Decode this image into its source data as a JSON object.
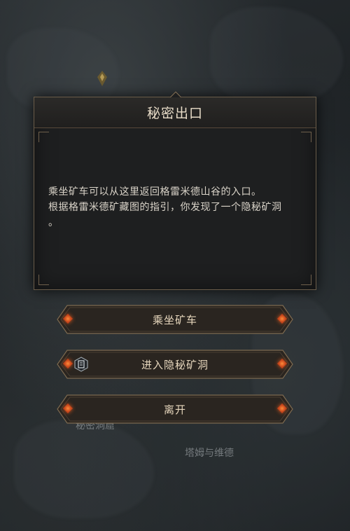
{
  "background": {
    "label_partial": "秘密洞窟",
    "label_npc": "塔姆与维德"
  },
  "dialog": {
    "title": "秘密出口",
    "line1": "乘坐矿车可以从这里返回格雷米德山谷的入口。",
    "line2": "根据格雷米德矿藏图的指引，你发现了一个隐秘矿洞",
    "line3": "。"
  },
  "buttons": [
    {
      "label": "乘坐矿车"
    },
    {
      "label": "进入隐秘矿洞",
      "icon": "book-icon"
    },
    {
      "label": "离开"
    }
  ],
  "colors": {
    "gold": "#8a7558",
    "text": "#e7d7bd",
    "gem": "#d0561f"
  }
}
